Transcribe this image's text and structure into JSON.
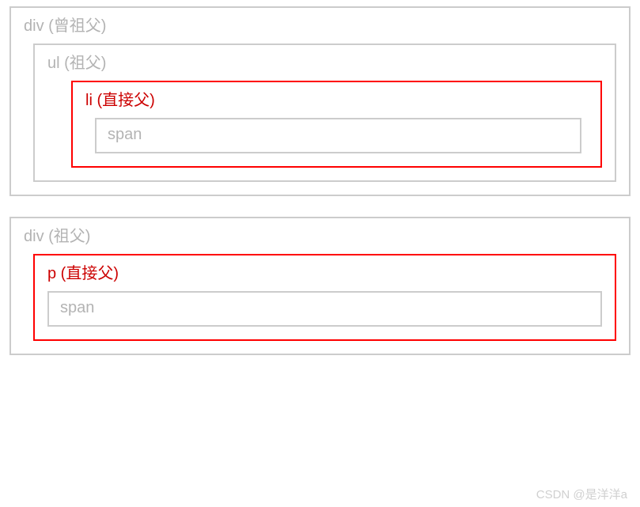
{
  "colors": {
    "gray_border": "#cccccc",
    "gray_text": "#b3b3b3",
    "red_border": "#ff0000",
    "red_text": "#cc0000"
  },
  "box1": {
    "outer_label": "div (曾祖父)",
    "ul_label": "ul (祖父)",
    "li_label": "li (直接父)",
    "span_label": "span"
  },
  "box2": {
    "outer_label": "div (祖父)",
    "p_label": "p (直接父)",
    "span_label": "span"
  },
  "watermark": "CSDN @是洋洋a"
}
